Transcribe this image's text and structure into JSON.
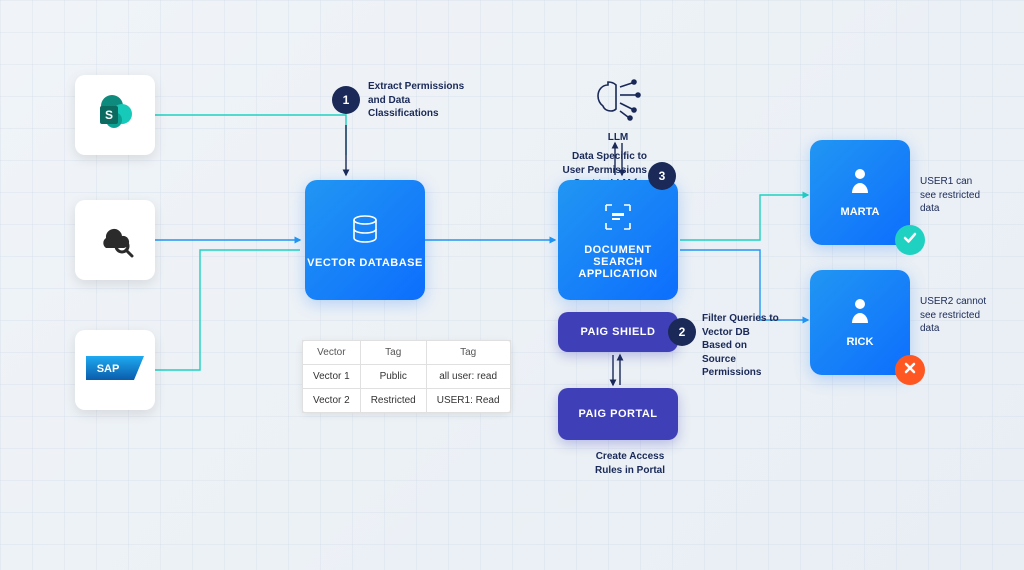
{
  "sources": {
    "sharepoint": "S",
    "cloud_search": "cloud-search",
    "sap": "SAP"
  },
  "steps": {
    "s1": {
      "num": "1",
      "text": "Extract Permissions and Data Classifications"
    },
    "s2": {
      "num": "2",
      "text": "Filter Queries to Vector DB Based on Source Permissions"
    },
    "s3": {
      "num": "3",
      "text": "Data Specific to User Permissions Sent to LLM for Summary"
    }
  },
  "nodes": {
    "vector_db": "VECTOR DATABASE",
    "doc_search": "DOCUMENT SEARCH APPLICATION",
    "paig_shield": "PAIG SHIELD",
    "paig_portal": "PAIG PORTAL",
    "llm": "LLM"
  },
  "portal_note": "Create Access Rules in Portal",
  "table": {
    "headers": [
      "Vector",
      "Tag",
      "Tag"
    ],
    "rows": [
      [
        "Vector 1",
        "Public",
        "all user: read"
      ],
      [
        "Vector 2",
        "Restricted",
        "USER1: Read"
      ]
    ]
  },
  "users": {
    "u1": {
      "name": "MARTA",
      "note": "USER1 can see restricted data"
    },
    "u2": {
      "name": "RICK",
      "note": "USER2 cannot see restricted data"
    }
  },
  "colors": {
    "navy": "#1a2957",
    "blue_gradient_a": "#2196f3",
    "blue_gradient_b": "#0d6efd",
    "purple": "#3f3fb8",
    "teal": "#1fd1c1",
    "orange": "#ff5722"
  }
}
